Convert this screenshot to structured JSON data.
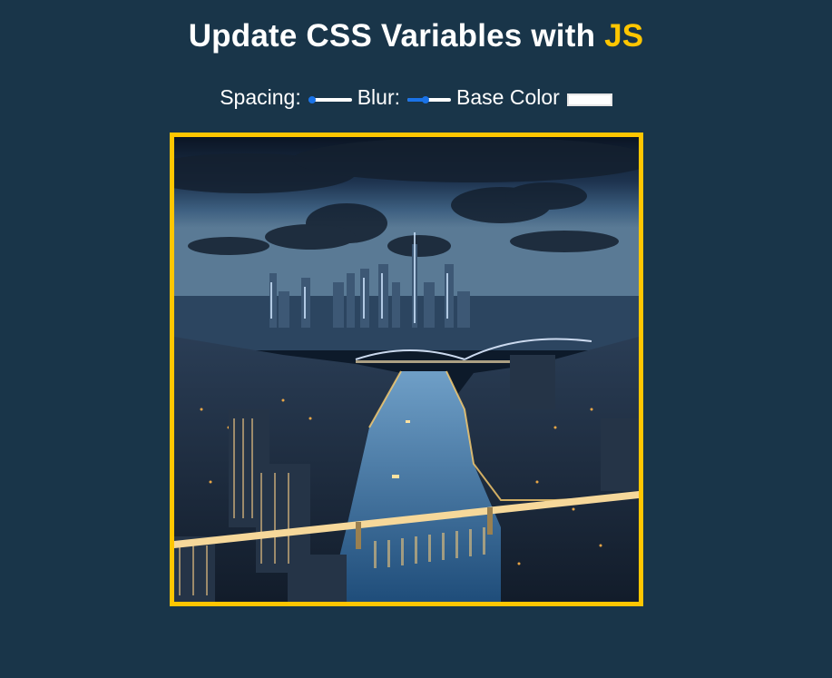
{
  "header": {
    "title_prefix": "Update CSS Variables with",
    "title_highlight": "JS"
  },
  "controls": {
    "spacing_label": "Spacing:",
    "spacing_value_fraction": 0.0,
    "blur_label": "Blur:",
    "blur_value_fraction": 0.4,
    "base_color_label": "Base Color",
    "base_color_value": "#ffc600"
  },
  "image": {
    "subject": "night-city-skyline-river-image"
  },
  "colors": {
    "background": "#193549",
    "accent": "#ffc600",
    "slider_blue": "#1a73e8"
  }
}
